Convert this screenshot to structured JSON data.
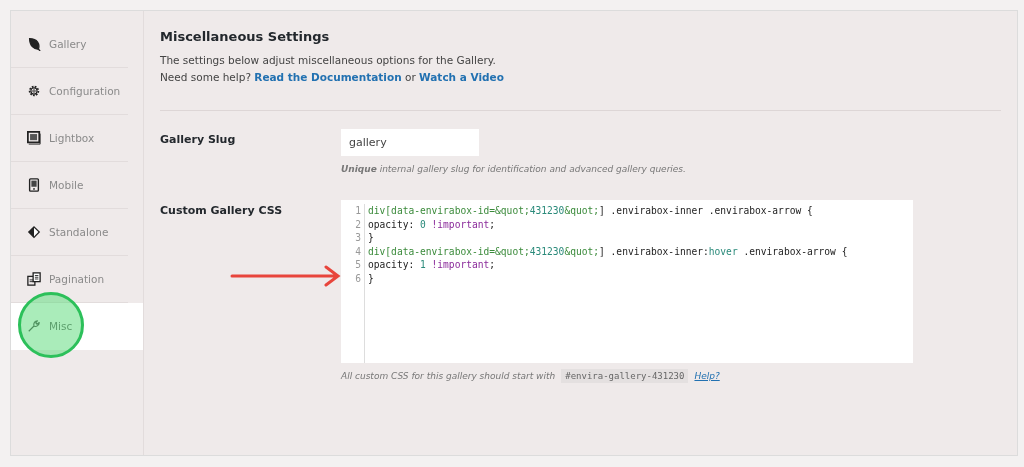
{
  "sidebar": {
    "items": [
      {
        "label": "Gallery",
        "kind": "leaf",
        "selected": false
      },
      {
        "label": "Configuration",
        "kind": "gear",
        "selected": false
      },
      {
        "label": "Lightbox",
        "kind": "lightbox",
        "selected": false
      },
      {
        "label": "Mobile",
        "kind": "mobile",
        "selected": false
      },
      {
        "label": "Standalone",
        "kind": "diamond",
        "selected": false
      },
      {
        "label": "Pagination",
        "kind": "pages",
        "selected": false
      },
      {
        "label": "Misc",
        "kind": "wrench",
        "selected": true
      }
    ]
  },
  "header": {
    "title": "Miscellaneous Settings",
    "description": "The settings below adjust miscellaneous options for the Gallery.",
    "help_prefix": "Need some help?",
    "doc_link": "Read the Documentation",
    "or": "or",
    "video_link": "Watch a Video"
  },
  "slug": {
    "label": "Gallery Slug",
    "value": "gallery",
    "help": "**Unique** internal gallery slug for identification and advanced gallery queries."
  },
  "css": {
    "label": "Custom Gallery CSS",
    "lines": [
      {
        "number": "1",
        "tokens": [
          {
            "kind": "tag",
            "text": "div[data-envirabox-id=&quot;"
          },
          {
            "kind": "number",
            "text": "431230"
          },
          {
            "kind": "tag",
            "text": "&quot;"
          },
          {
            "kind": "plain",
            "text": "] .envirabox-inner .envirabox-arrow {"
          }
        ]
      },
      {
        "number": "2",
        "tokens": [
          {
            "kind": "plain",
            "text": "opacity: "
          },
          {
            "kind": "number",
            "text": "0"
          },
          {
            "kind": "keyword",
            "text": " !important"
          },
          {
            "kind": "plain",
            "text": ";"
          }
        ]
      },
      {
        "number": "3",
        "tokens": [
          {
            "kind": "plain",
            "text": "}"
          }
        ]
      },
      {
        "number": "4",
        "tokens": [
          {
            "kind": "tag",
            "text": "div[data-envirabox-id=&quot;"
          },
          {
            "kind": "number",
            "text": "431230"
          },
          {
            "kind": "tag",
            "text": "&quot;"
          },
          {
            "kind": "plain",
            "text": "] .envirabox-inner:"
          },
          {
            "kind": "number",
            "text": "hover"
          },
          {
            "kind": "plain",
            "text": " .envirabox-arrow {"
          }
        ]
      },
      {
        "number": "5",
        "tokens": [
          {
            "kind": "plain",
            "text": "opacity: "
          },
          {
            "kind": "number",
            "text": "1"
          },
          {
            "kind": "keyword",
            "text": " !important"
          },
          {
            "kind": "plain",
            "text": ";"
          }
        ]
      },
      {
        "number": "6",
        "tokens": [
          {
            "kind": "plain",
            "text": "}"
          }
        ]
      }
    ],
    "help": "All custom CSS for this gallery should start with",
    "selector": "#envira-gallery-431230",
    "help_link": "Help?"
  }
}
